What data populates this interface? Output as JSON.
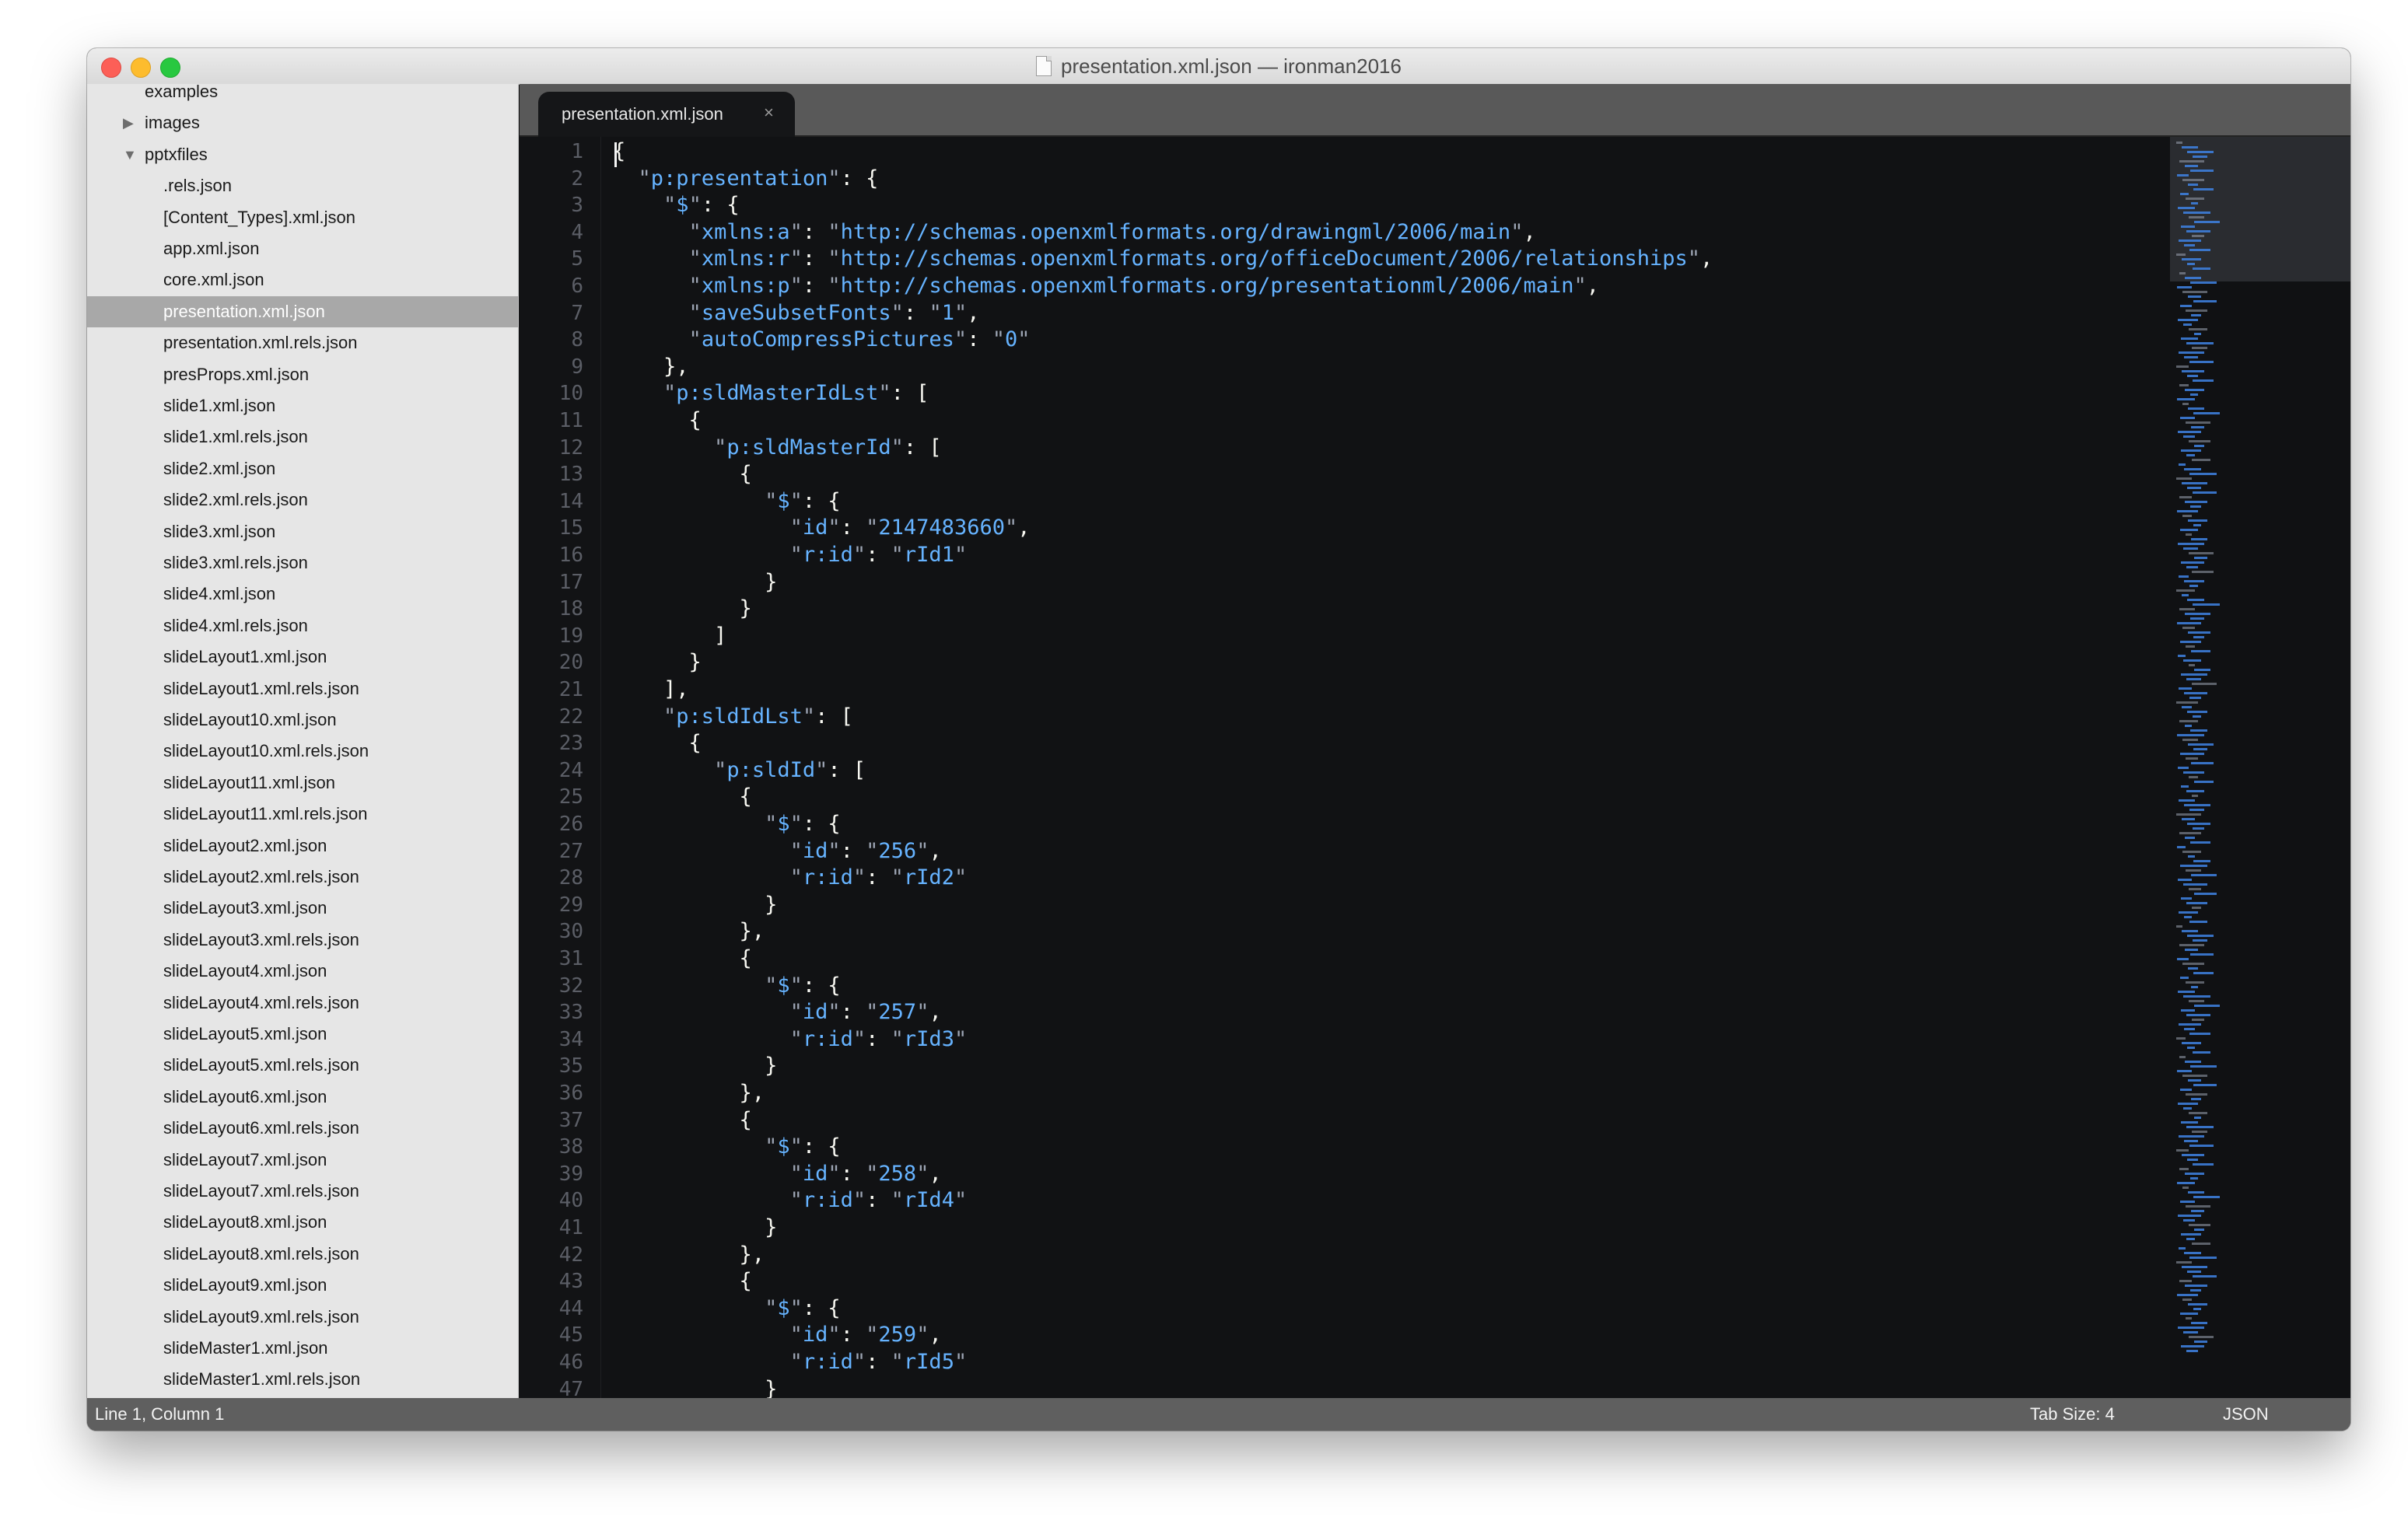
{
  "window": {
    "title": "presentation.xml.json — ironman2016"
  },
  "sidebar": {
    "partial_top_label": "examples",
    "folders": [
      {
        "label": "images",
        "expanded": false
      },
      {
        "label": "pptxfiles",
        "expanded": true
      }
    ],
    "files": [
      ".rels.json",
      "[Content_Types].xml.json",
      "app.xml.json",
      "core.xml.json",
      "presentation.xml.json",
      "presentation.xml.rels.json",
      "presProps.xml.json",
      "slide1.xml.json",
      "slide1.xml.rels.json",
      "slide2.xml.json",
      "slide2.xml.rels.json",
      "slide3.xml.json",
      "slide3.xml.rels.json",
      "slide4.xml.json",
      "slide4.xml.rels.json",
      "slideLayout1.xml.json",
      "slideLayout1.xml.rels.json",
      "slideLayout10.xml.json",
      "slideLayout10.xml.rels.json",
      "slideLayout11.xml.json",
      "slideLayout11.xml.rels.json",
      "slideLayout2.xml.json",
      "slideLayout2.xml.rels.json",
      "slideLayout3.xml.json",
      "slideLayout3.xml.rels.json",
      "slideLayout4.xml.json",
      "slideLayout4.xml.rels.json",
      "slideLayout5.xml.json",
      "slideLayout5.xml.rels.json",
      "slideLayout6.xml.json",
      "slideLayout6.xml.rels.json",
      "slideLayout7.xml.json",
      "slideLayout7.xml.rels.json",
      "slideLayout8.xml.json",
      "slideLayout8.xml.rels.json",
      "slideLayout9.xml.json",
      "slideLayout9.xml.rels.json",
      "slideMaster1.xml.json",
      "slideMaster1.xml.rels.json"
    ],
    "selected_file": "presentation.xml.json"
  },
  "editor": {
    "active_tab": "presentation.xml.json",
    "tab_close_icon": "×",
    "lines": [
      "{",
      "  \"p:presentation\": {",
      "    \"$\": {",
      "      \"xmlns:a\": \"http://schemas.openxmlformats.org/drawingml/2006/main\",",
      "      \"xmlns:r\": \"http://schemas.openxmlformats.org/officeDocument/2006/relationships\",",
      "      \"xmlns:p\": \"http://schemas.openxmlformats.org/presentationml/2006/main\",",
      "      \"saveSubsetFonts\": \"1\",",
      "      \"autoCompressPictures\": \"0\"",
      "    },",
      "    \"p:sldMasterIdLst\": [",
      "      {",
      "        \"p:sldMasterId\": [",
      "          {",
      "            \"$\": {",
      "              \"id\": \"2147483660\",",
      "              \"r:id\": \"rId1\"",
      "            }",
      "          }",
      "        ]",
      "      }",
      "    ],",
      "    \"p:sldIdLst\": [",
      "      {",
      "        \"p:sldId\": [",
      "          {",
      "            \"$\": {",
      "              \"id\": \"256\",",
      "              \"r:id\": \"rId2\"",
      "            }",
      "          },",
      "          {",
      "            \"$\": {",
      "              \"id\": \"257\",",
      "              \"r:id\": \"rId3\"",
      "            }",
      "          },",
      "          {",
      "            \"$\": {",
      "              \"id\": \"258\",",
      "              \"r:id\": \"rId4\"",
      "            }",
      "          },",
      "          {",
      "            \"$\": {",
      "              \"id\": \"259\",",
      "              \"r:id\": \"rId5\"",
      "            }"
    ]
  },
  "status_bar": {
    "position": "Line 1, Column 1",
    "tab_size": "Tab Size: 4",
    "syntax": "JSON"
  },
  "colors": {
    "editor_background": "#111214",
    "syntax_key": "#66b3ff",
    "sidebar_selected": "#a8a8a8"
  }
}
